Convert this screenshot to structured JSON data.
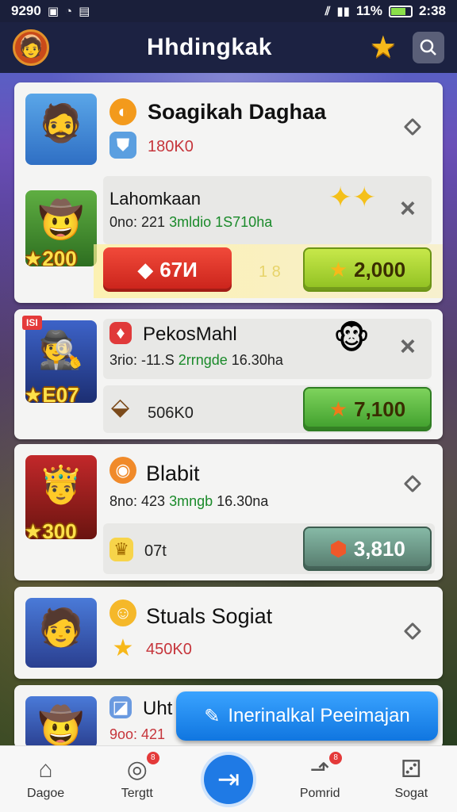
{
  "status": {
    "time": "9290",
    "battery_text": "11%",
    "clock": "2:38"
  },
  "header": {
    "title": "Hhdingkak",
    "avatar_icon": "avatar-icon",
    "star_icon": "star-icon",
    "search_icon": "search-icon"
  },
  "cards": [
    {
      "title": "Soagikah Daghaa",
      "subtitle": "180K0",
      "panel_title": "Lahomkaan",
      "stats_a": "0no: 221",
      "stats_b": "3mldio",
      "stats_c": "1S710ha",
      "thumb_badge": "200",
      "red_button": "67И",
      "mid_value": "1 8",
      "lime_button": "2,000"
    },
    {
      "title": "PekosMahl",
      "stats_a": "3rio: -11.S",
      "stats_b": "2rrngde",
      "stats_c": "16.30ha",
      "thumb_badge": "E07",
      "thumb_tag": "ISI",
      "mid_value": "506K0",
      "green_button": "7,100"
    },
    {
      "title": "Blabit",
      "stats_a": "8no: 423",
      "stats_b": "3mngb",
      "stats_c": "16.30na",
      "thumb_badge": "300",
      "mid_value": "07t",
      "teal_button": "3,810"
    },
    {
      "title": "Stuals Sogiat",
      "subtitle": "450K0"
    },
    {
      "title": "Uht",
      "stats_a": "9oo: 421"
    }
  ],
  "fab": {
    "label": "Inerinalkal Peeimajan"
  },
  "nav": [
    {
      "label": "Dagoe",
      "icon": "home-icon"
    },
    {
      "label": "Tergtt",
      "icon": "target-icon",
      "badge": "8"
    },
    {
      "label": "",
      "icon": "arrow-right-icon"
    },
    {
      "label": "Pomrid",
      "icon": "chart-icon",
      "badge": "8"
    },
    {
      "label": "Sogat",
      "icon": "dice-icon"
    }
  ]
}
